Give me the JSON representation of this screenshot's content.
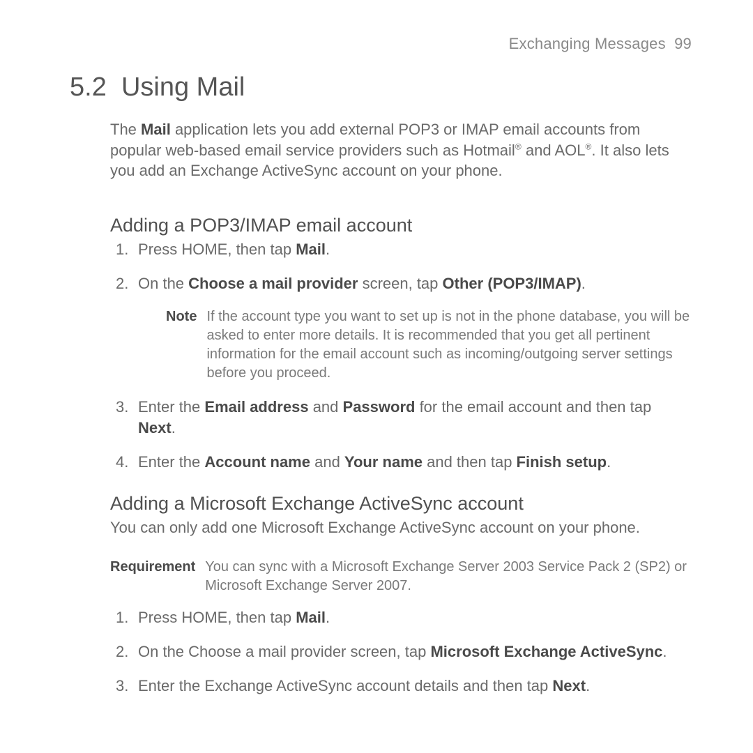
{
  "running_head": {
    "title": "Exchanging Messages",
    "page_number": "99"
  },
  "section": {
    "number": "5.2",
    "title": "Using Mail"
  },
  "intro": {
    "pre": "The ",
    "mail": "Mail",
    "post": " application lets you add external POP3 or IMAP email accounts from popular web-based email service providers such as Hotmail",
    "sup1": "®",
    "mid": " and AOL",
    "sup2": "®",
    "tail": ". It also lets you add an Exchange ActiveSync account on your phone."
  },
  "sub1": {
    "heading": "Adding a POP3/IMAP email account",
    "step1": {
      "a": "Press HOME, then tap ",
      "b": "Mail",
      "c": "."
    },
    "step2": {
      "a": "On the ",
      "b": "Choose a mail provider",
      "c": " screen, tap ",
      "d": "Other (POP3/IMAP)",
      "e": "."
    },
    "note": {
      "label": "Note",
      "text": "If the account type you want to set up is not in the phone database, you will be asked to enter more details. It is recommended that you get all pertinent information for the email account such as incoming/outgoing server settings before you proceed."
    },
    "step3": {
      "a": "Enter the ",
      "b": "Email address",
      "c": " and ",
      "d": "Password",
      "e": " for the email account and then tap ",
      "f": "Next",
      "g": "."
    },
    "step4": {
      "a": "Enter the ",
      "b": "Account name",
      "c": " and ",
      "d": "Your name",
      "e": " and then tap ",
      "f": "Finish setup",
      "g": "."
    }
  },
  "sub2": {
    "heading": "Adding a Microsoft Exchange ActiveSync account",
    "body": "You can only add one Microsoft Exchange ActiveSync account on your phone.",
    "requirement": {
      "label": "Requirement",
      "text": "You can sync with a Microsoft Exchange Server 2003 Service Pack 2 (SP2) or Microsoft Exchange Server 2007."
    },
    "step1": {
      "a": "Press HOME, then tap ",
      "b": "Mail",
      "c": "."
    },
    "step2": {
      "a": "On the Choose a mail provider screen, tap ",
      "b": "Microsoft Exchange ActiveSync",
      "c": "."
    },
    "step3": {
      "a": "Enter the Exchange ActiveSync account details and then tap ",
      "b": "Next",
      "c": "."
    }
  }
}
